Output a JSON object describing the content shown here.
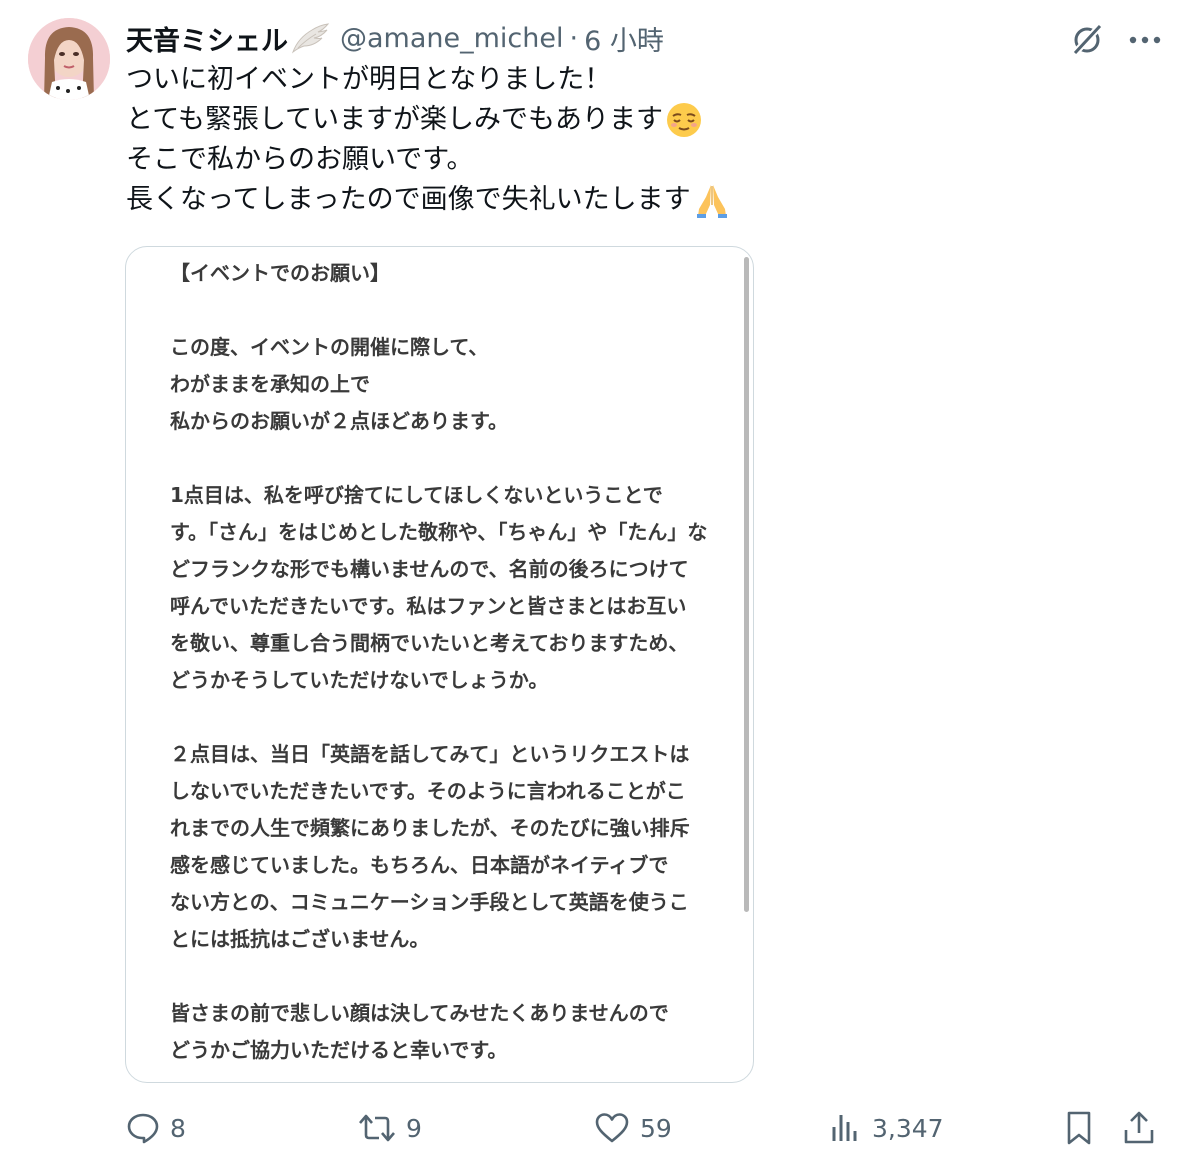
{
  "author": {
    "display_name": "天音ミシェル",
    "handle": "@amane_michel",
    "separator": "·",
    "time": "6 小時"
  },
  "tweet": {
    "lines": [
      "ついに初イベントが明日となりました！",
      "とても緊張していますが楽しみでもあります",
      "そこで私からのお願いです。",
      "長くなってしまったので画像で失礼いたします"
    ],
    "line_emojis": [
      "",
      "relieved-face",
      "",
      "folded-hands"
    ]
  },
  "media": {
    "title": "【イベントでのお願い】",
    "paragraphs": [
      [
        "この度、イベントの開催に際して、",
        "わがままを承知の上で",
        "私からのお願いが２点ほどあります。"
      ],
      [
        "1点目は、私を呼び捨てにしてほしくないということで",
        "す。「さん」をはじめとした敬称や、「ちゃん」や「たん」な",
        "どフランクな形でも構いませんので、名前の後ろにつけて",
        "呼んでいただきたいです。私はファンと皆さまとはお互い",
        "を敬い、尊重し合う間柄でいたいと考えておりますため、",
        "どうかそうしていただけないでしょうか。"
      ],
      [
        "２点目は、当日「英語を話してみて」というリクエストは",
        "しないでいただきたいです。そのように言われることがこ",
        "れまでの人生で頻繁にありましたが、そのたびに強い排斥",
        "感を感じていました。もちろん、日本語がネイティブで",
        "ない方との、コミュニケーション手段として英語を使うこ",
        "とには抵抗はございません。"
      ],
      [
        "皆さまの前で悲しい顔は決してみせたくありませんので",
        "どうかご協力いただけると幸いです。"
      ]
    ]
  },
  "actions": {
    "reply_count": "8",
    "retweet_count": "9",
    "like_count": "59",
    "views_count": "3,347"
  },
  "colors": {
    "text": "#0f1419",
    "secondary": "#536471",
    "border": "#cfd9de"
  }
}
